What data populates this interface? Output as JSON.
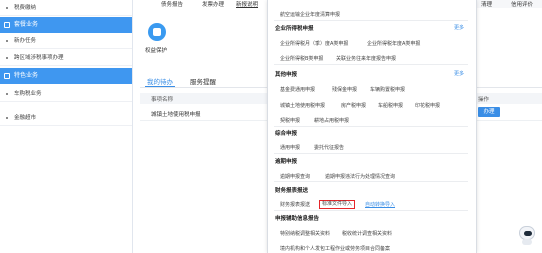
{
  "sidebar": {
    "items_top": [
      {
        "label": "税费缴纳"
      }
    ],
    "group1": {
      "label": "套餐业务"
    },
    "group1_items": [
      {
        "label": "新办任务"
      },
      {
        "label": "跨区域涉税事项办理"
      }
    ],
    "group2": {
      "label": "特色业务"
    },
    "group2_items": [
      {
        "label": "车购税业务"
      },
      {
        "label": "金融超市"
      }
    ]
  },
  "top_tabs": [
    {
      "label": "债务报告"
    },
    {
      "label": "发票办理"
    },
    {
      "label": "新报说明"
    }
  ],
  "right_top": [
    {
      "label": "清理"
    },
    {
      "label": "信用评价"
    }
  ],
  "service_card": {
    "label": "权益保护"
  },
  "tabs": [
    {
      "label": "我的待办"
    },
    {
      "label": "服务提醒"
    }
  ],
  "table": {
    "headers": [
      "事项名称",
      "操作"
    ],
    "rows": [
      {
        "name": "城镇土地使用税申报",
        "action": "办理"
      }
    ]
  },
  "menu": {
    "top_item": "航空运输企业年度清算申报",
    "sections": [
      {
        "title": "企业所得税申报",
        "more": "更多",
        "rows": [
          [
            "企业所得税月（季）度A类申报",
            "企业所得税年度A类申报"
          ],
          [
            "企业所得税B类申报",
            "关联业务往来年度报告申报"
          ]
        ]
      },
      {
        "title": "其他申报",
        "more": "更多",
        "rows": [
          [
            "基金费通用申报",
            "残保金申报",
            "车辆购置税申报"
          ],
          [
            "城镇土地使用税申报",
            "房产税申报",
            "车船税申报",
            "印花税申报"
          ],
          [
            "契税申报",
            "耕地占用税申报"
          ]
        ]
      },
      {
        "title": "综合申报",
        "rows": [
          [
            "通用申报",
            "委托代征报告"
          ]
        ]
      },
      {
        "title": "逾期申报",
        "rows": [
          [
            "逾期申报查询",
            "逾期申报违法行为处理情况查询"
          ]
        ]
      },
      {
        "title": "财务报表报送",
        "rows": [
          [
            "财务报表报送",
            "标准文件导入",
            "自动转换导入"
          ]
        ]
      },
      {
        "title": "申报辅助信息报告",
        "rows": [
          [
            "特别纳税调整相关资料",
            "税收统计调查相关资料"
          ],
          [
            "境内机构和个人发包工程作业或劳务项目合同备案"
          ]
        ]
      }
    ]
  },
  "colors": {
    "accent": "#3a8ee6",
    "sidebar_active": "#3f97f0",
    "highlight_box": "#e5262a"
  }
}
